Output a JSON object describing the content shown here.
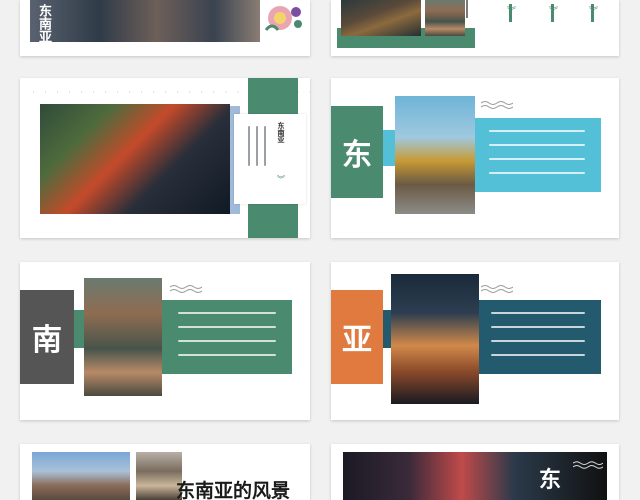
{
  "colors": {
    "green": "#4a8a6e",
    "cyan": "#53c0d8",
    "charcoal": "#555555",
    "orange": "#e07a3e",
    "teal": "#245a6e"
  },
  "slides": {
    "s1": {
      "title": "东南亚"
    },
    "s2": {
      "side_text": ""
    },
    "s3": {
      "heading": "东南亚"
    },
    "s4": {
      "char": "东"
    },
    "s5": {
      "char": "南"
    },
    "s6": {
      "char": "亚"
    },
    "s7": {
      "title": "东南亚的风景"
    },
    "s8": {
      "char": "东"
    }
  },
  "icons": [
    "wave-icon",
    "chevron-down-icon"
  ]
}
